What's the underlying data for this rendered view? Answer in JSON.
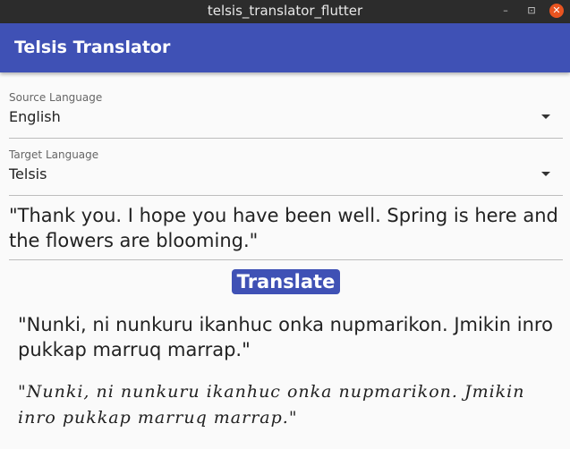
{
  "window": {
    "title": "telsis_translator_flutter",
    "min": "–",
    "max": "⊡",
    "close": "✕"
  },
  "appbar": {
    "title": "Telsis Translator"
  },
  "source_language": {
    "label": "Source Language",
    "value": "English"
  },
  "target_language": {
    "label": "Target Language",
    "value": "Telsis"
  },
  "source_text": "\"Thank you. I hope you have been well. Spring is here and the flowers are blooming.\"",
  "translate_label": "Translate",
  "translation_text": "\"Nunki, ni nunkuru ikanhuc onka nupmarikon. Jmikin inro pukkap marruq marrap.\"",
  "script_text": "\"Nunki, ni nunkuru ikanhuc onka nupmarikon. Jmikin inro pukkap marruq marrap.\""
}
